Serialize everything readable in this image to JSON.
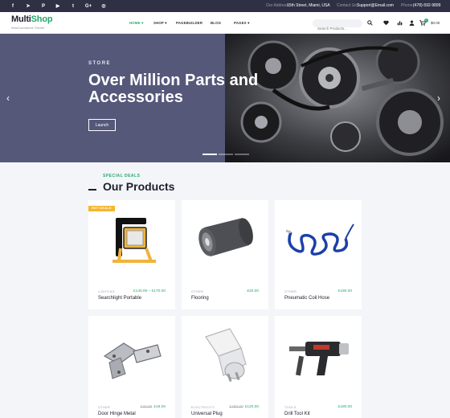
{
  "topbar": {
    "social": [
      {
        "icon": "facebook-icon",
        "glyph": "f"
      },
      {
        "icon": "telegram-icon",
        "glyph": "➤"
      },
      {
        "icon": "pinterest-icon",
        "glyph": "P"
      },
      {
        "icon": "youtube-icon",
        "glyph": "▶"
      },
      {
        "icon": "twitter-icon",
        "glyph": "t"
      },
      {
        "icon": "google-plus-icon",
        "glyph": "G+"
      },
      {
        "icon": "instagram-icon",
        "glyph": "◎"
      }
    ],
    "address_label": "Our Address:",
    "address_value": "15th Street, Miami, USA",
    "contact_label": "Contact Us:",
    "contact_value": "Support@Email.com",
    "phone_label": "Phone:",
    "phone_value": "(478)-592-9899"
  },
  "header": {
    "logo_main": "Multi",
    "logo_accent": "Shop",
    "tagline": "WooCommerce Theme",
    "nav": [
      "HOME",
      "SHOP",
      "PAGEBUILDER",
      "BLOG",
      "PAGES"
    ],
    "search_placeholder": "Search Products...",
    "cart_count": "0",
    "cart_total": "$0.00"
  },
  "hero": {
    "eyebrow": "STORE",
    "title": "Over Million Parts and Accessories",
    "button": "Launch"
  },
  "section": {
    "label": "SPECIAL DEALS",
    "title": "Our Products"
  },
  "products": [
    {
      "badge": "HOT DEALS",
      "category": "LIGHTING",
      "price_old": "",
      "price": "£140.00 – £170.00",
      "name": "Searchlight Portable"
    },
    {
      "badge": "",
      "category": "OTHER",
      "price_old": "",
      "price": "£20.00",
      "name": "Flooring"
    },
    {
      "badge": "",
      "category": "OTHER",
      "price_old": "",
      "price": "£180.00",
      "name": "Pneumatic Coil Hose"
    },
    {
      "badge": "",
      "category": "OTHER",
      "price_old": "£20.00",
      "price": "£18.00",
      "name": "Door Hinge Metal"
    },
    {
      "badge": "",
      "category": "ELECTRICITY",
      "price_old": "£180.00",
      "price": "£120.00",
      "name": "Universal Plug"
    },
    {
      "badge": "",
      "category": "TOOLS",
      "price_old": "",
      "price": "£180.00",
      "name": "Drill Tool Kit"
    }
  ],
  "colors": {
    "accent": "#23a96c",
    "topbar": "#2f3044",
    "hero_bg": "#56587a",
    "badge": "#f4b730"
  }
}
